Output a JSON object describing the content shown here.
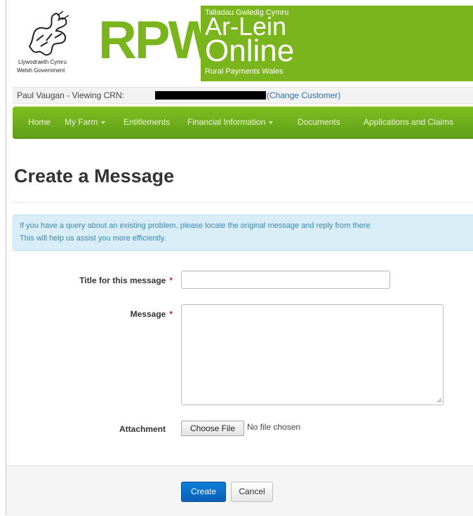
{
  "header": {
    "gov_line1": "Llywodraeth Cymru",
    "gov_line2": "Welsh Government",
    "rpw": "RPW",
    "online_welsh": "Taliadau Gwledig Cymru",
    "online_big1": "Ar-Lein",
    "online_big2": "Online",
    "online_sub": "Rural Payments Wales",
    "icons": [
      "dragon-logo-icon"
    ]
  },
  "customer": {
    "viewing_text": "Paul Vaugan - Viewing CRN:",
    "change_link": "(Change Customer)"
  },
  "nav": {
    "items": [
      "Home",
      "My Farm",
      "Entitlements",
      "Financial Information",
      "Documents",
      "Applications and Claims"
    ]
  },
  "page": {
    "title": "Create a Message"
  },
  "alert": {
    "line1": "If you have a query about an existing problem, please locate the original message and reply from there",
    "line2": "This will help us assist you more efficiently."
  },
  "form": {
    "title_label": "Title for this message",
    "message_label": "Message",
    "required_mark": "*",
    "attachment_label": "Attachment",
    "choose_file": "Choose File",
    "no_file": "No file chosen",
    "title_value": "",
    "message_value": ""
  },
  "actions": {
    "create": "Create",
    "cancel": "Cancel"
  },
  "colors": {
    "brand_green": "#7ab51d",
    "nav_green": "#5e9d18",
    "link_blue": "#2a6fb0",
    "primary_blue": "#0a5fb5",
    "alert_bg": "#d9edf7"
  }
}
